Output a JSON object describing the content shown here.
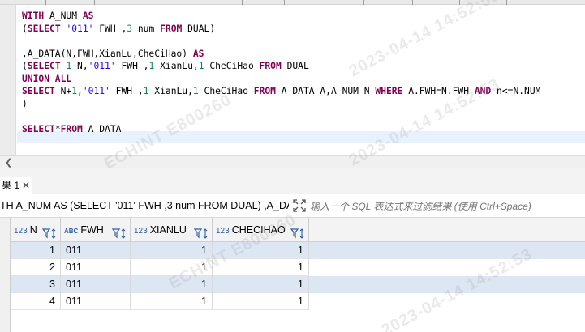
{
  "editor": {
    "lines": [
      [
        {
          "t": "WITH",
          "k": "kw"
        },
        {
          "t": " A_NUM ",
          "k": ""
        },
        {
          "t": "AS",
          "k": "kw"
        }
      ],
      [
        {
          "t": "(",
          "k": ""
        },
        {
          "t": "SELECT",
          "k": "kw"
        },
        {
          "t": " ",
          "k": ""
        },
        {
          "t": "'011'",
          "k": "str"
        },
        {
          "t": " FWH ,",
          "k": ""
        },
        {
          "t": "3",
          "k": "num"
        },
        {
          "t": " num ",
          "k": ""
        },
        {
          "t": "FROM",
          "k": "kw"
        },
        {
          "t": " DUAL)",
          "k": ""
        }
      ],
      [],
      [
        {
          "t": ",A_DATA(N,FWH,XianLu,CheCiHao) ",
          "k": ""
        },
        {
          "t": "AS",
          "k": "kw"
        }
      ],
      [
        {
          "t": "(",
          "k": ""
        },
        {
          "t": "SELECT",
          "k": "kw"
        },
        {
          "t": " ",
          "k": ""
        },
        {
          "t": "1",
          "k": "num"
        },
        {
          "t": " N,",
          "k": ""
        },
        {
          "t": "'011'",
          "k": "str"
        },
        {
          "t": " FWH ,",
          "k": ""
        },
        {
          "t": "1",
          "k": "num"
        },
        {
          "t": " XianLu,",
          "k": ""
        },
        {
          "t": "1",
          "k": "num"
        },
        {
          "t": " CheCiHao ",
          "k": ""
        },
        {
          "t": "FROM",
          "k": "kw"
        },
        {
          "t": " DUAL",
          "k": ""
        }
      ],
      [
        {
          "t": "UNION ALL",
          "k": "kw"
        }
      ],
      [
        {
          "t": "SELECT",
          "k": "kw"
        },
        {
          "t": " N+",
          "k": ""
        },
        {
          "t": "1",
          "k": "num"
        },
        {
          "t": ",",
          "k": ""
        },
        {
          "t": "'011'",
          "k": "str"
        },
        {
          "t": " FWH ,",
          "k": ""
        },
        {
          "t": "1",
          "k": "num"
        },
        {
          "t": " XianLu,",
          "k": ""
        },
        {
          "t": "1",
          "k": "num"
        },
        {
          "t": " CheCiHao ",
          "k": ""
        },
        {
          "t": "FROM",
          "k": "kw"
        },
        {
          "t": " A_DATA A,A_NUM N ",
          "k": ""
        },
        {
          "t": "WHERE",
          "k": "kw"
        },
        {
          "t": " A.FWH=N.FWH ",
          "k": ""
        },
        {
          "t": "AND",
          "k": "kw"
        },
        {
          "t": " n<=N.NUM",
          "k": ""
        }
      ],
      [
        {
          "t": ")",
          "k": ""
        }
      ],
      [],
      [
        {
          "t": "SELECT",
          "k": "kw"
        },
        {
          "t": "*",
          "k": ""
        },
        {
          "t": "FROM",
          "k": "kw"
        },
        {
          "t": " A_DATA",
          "k": ""
        }
      ]
    ]
  },
  "result_tab": {
    "label": "果 1",
    "close": "✕"
  },
  "filter": {
    "query_text": "TH A_NUM AS (SELECT '011' FWH ,3 num FROM DUAL) ,A_DA",
    "placeholder": "输入一个 SQL 表达式来过滤结果 (使用 Ctrl+Space)"
  },
  "grid": {
    "columns": [
      {
        "type": "123",
        "name": "N"
      },
      {
        "type": "ABC",
        "name": "FWH"
      },
      {
        "type": "123",
        "name": "XIANLU"
      },
      {
        "type": "123",
        "name": "CHECIHAO"
      }
    ],
    "rows": [
      [
        "1",
        "011",
        "1",
        "1"
      ],
      [
        "2",
        "011",
        "1",
        "1"
      ],
      [
        "3",
        "011",
        "1",
        "1"
      ],
      [
        "4",
        "011",
        "1",
        "1"
      ]
    ]
  },
  "watermark": {
    "lines": [
      "ECHINT  E800260",
      "2023-04-14  14:52:53"
    ]
  },
  "colors": {
    "keyword": "#7f0055",
    "string": "#2a00ff",
    "number": "#098658",
    "row_alt": "#dde6f3",
    "type_icon": "#2d5fa8"
  }
}
